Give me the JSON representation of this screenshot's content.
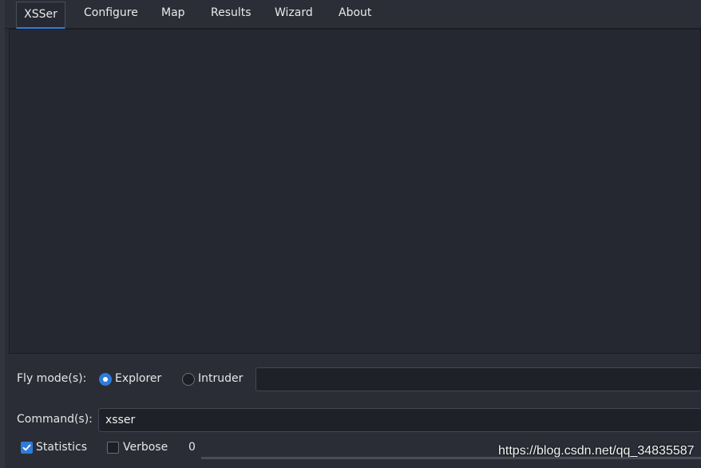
{
  "tabs": [
    {
      "label": "XSSer",
      "active": true
    },
    {
      "label": "Configure",
      "active": false
    },
    {
      "label": "Map",
      "active": false
    },
    {
      "label": "Results",
      "active": false
    },
    {
      "label": "Wizard",
      "active": false
    },
    {
      "label": "About",
      "active": false
    }
  ],
  "fly_mode": {
    "label": "Fly mode(s):",
    "options": [
      {
        "label": "Explorer",
        "selected": true
      },
      {
        "label": "Intruder",
        "selected": false
      }
    ],
    "input_value": ""
  },
  "command": {
    "label": "Command(s):",
    "value": "xsser"
  },
  "options_row": {
    "statistics": {
      "label": "Statistics",
      "checked": true
    },
    "verbose": {
      "label": "Verbose",
      "checked": false
    },
    "verbose_level": "0"
  },
  "watermark": "https://blog.csdn.net/qq_34835587",
  "colors": {
    "accent": "#2f7bd8",
    "background": "#2a2d36",
    "panel": "#252731"
  }
}
